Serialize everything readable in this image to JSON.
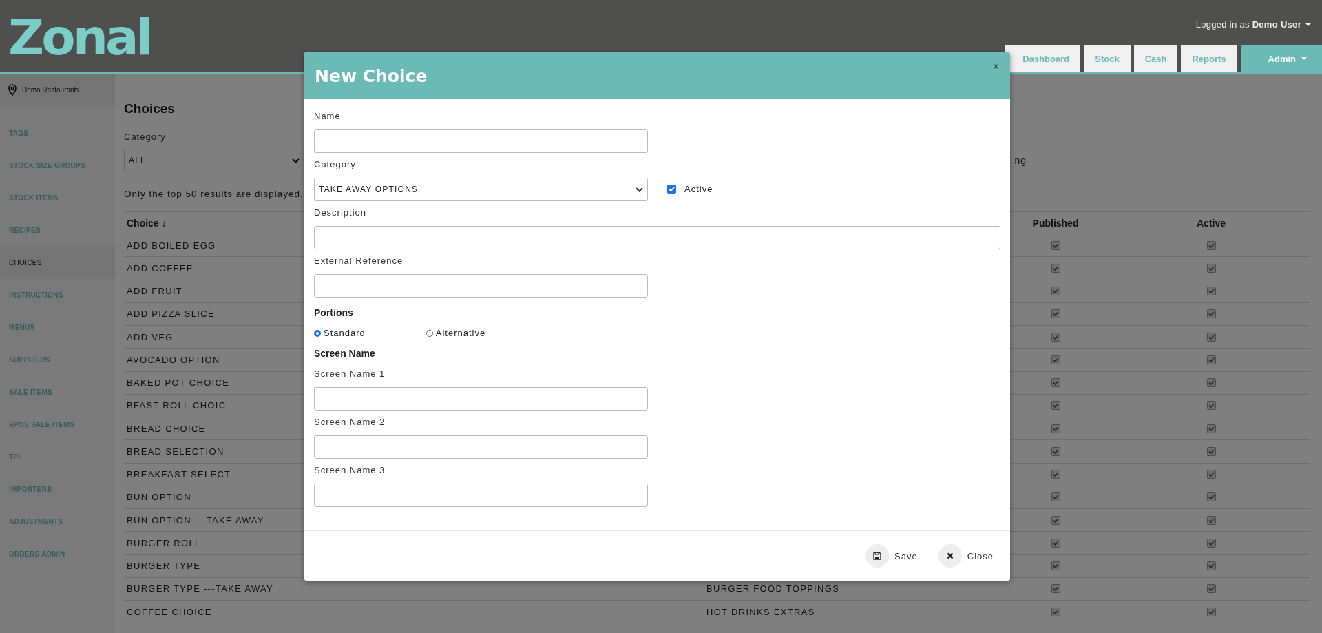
{
  "header": {
    "logo": "Zonal",
    "user": {
      "prefix": "Logged in as",
      "name": "Demo User"
    },
    "nav": [
      {
        "label": "Dashboard",
        "selected": false,
        "dropdown": false
      },
      {
        "label": "Stock",
        "selected": false,
        "dropdown": false
      },
      {
        "label": "Cash",
        "selected": false,
        "dropdown": false
      },
      {
        "label": "Reports",
        "selected": false,
        "dropdown": false
      },
      {
        "label": "Admin",
        "selected": true,
        "dropdown": true
      }
    ]
  },
  "sidebar": {
    "site": "Demo Restaurants",
    "items": [
      {
        "label": "TAGS",
        "selected": false
      },
      {
        "label": "STOCK SIZE GROUPS",
        "selected": false
      },
      {
        "label": "STOCK ITEMS",
        "selected": false
      },
      {
        "label": "RECIPES",
        "selected": false
      },
      {
        "label": "CHOICES",
        "selected": true
      },
      {
        "label": "INSTRUCTIONS",
        "selected": false
      },
      {
        "label": "MENUS",
        "selected": false
      },
      {
        "label": "SUPPLIERS",
        "selected": false
      },
      {
        "label": "SALE ITEMS",
        "selected": false
      },
      {
        "label": "EPOS SALE ITEMS",
        "selected": false
      },
      {
        "label": "TPI",
        "selected": false
      },
      {
        "label": "IMPORTERS",
        "selected": false
      },
      {
        "label": "ADJUSTMENTS",
        "selected": false
      },
      {
        "label": "ORDERS ADMIN",
        "selected": false
      }
    ]
  },
  "page": {
    "title": "Choices",
    "category_label": "Category",
    "category_value": "ALL",
    "filter_fragment": "ng",
    "notice": "Only the top 50 results are displayed.",
    "table": {
      "columns": [
        {
          "label": "Choice",
          "sort_glyph": "↓"
        },
        {
          "label": "Published"
        },
        {
          "label": "Active"
        }
      ],
      "rows": [
        {
          "choice": "ADD BOILED EGG",
          "published": true,
          "active": true
        },
        {
          "choice": "ADD COFFEE",
          "published": true,
          "active": true
        },
        {
          "choice": "ADD FRUIT",
          "published": true,
          "active": true
        },
        {
          "choice": "ADD PIZZA SLICE",
          "published": true,
          "active": true
        },
        {
          "choice": "ADD VEG",
          "published": true,
          "active": true
        },
        {
          "choice": "AVOCADO OPTION",
          "published": true,
          "active": true
        },
        {
          "choice": "BAKED POT CHOICE",
          "published": true,
          "active": true
        },
        {
          "choice": "BFAST ROLL CHOIC",
          "published": true,
          "active": true
        },
        {
          "choice": "BREAD CHOICE",
          "published": true,
          "active": true
        },
        {
          "choice": "BREAD SELECTION",
          "published": true,
          "active": true
        },
        {
          "choice": "BREAKFAST SELECT",
          "published": true,
          "active": true
        },
        {
          "choice": "BUN OPTION",
          "published": true,
          "active": true
        },
        {
          "choice": "BUN OPTION ---TAKE AWAY",
          "published": true,
          "active": true
        },
        {
          "choice": "BURGER ROLL",
          "published": true,
          "active": true
        },
        {
          "choice": "BURGER TYPE",
          "published": true,
          "active": true
        },
        {
          "choice": "BURGER TYPE ---TAKE AWAY",
          "category": "BURGER FOOD TOPPINGS",
          "published": true,
          "active": true
        },
        {
          "choice": "COFFEE CHOICE",
          "category": "HOT DRINKS EXTRAS",
          "published": true,
          "active": true
        }
      ]
    }
  },
  "modal": {
    "title": "New Choice",
    "close_glyph": "×",
    "fields": [
      {
        "kind": "text",
        "label": "Name",
        "wide": false
      },
      {
        "kind": "select",
        "label": "Category",
        "value": "TAKE AWAY OPTIONS",
        "checkbox": {
          "label": "Active",
          "checked": true
        }
      },
      {
        "kind": "text",
        "label": "Description",
        "wide": true
      },
      {
        "kind": "text",
        "label": "External Reference",
        "wide": false
      },
      {
        "kind": "radio",
        "label": "Portions",
        "options": [
          {
            "label": "Standard",
            "selected": true
          },
          {
            "label": "Alternative",
            "selected": false
          }
        ]
      },
      {
        "kind": "heading",
        "label": "Screen Name"
      },
      {
        "kind": "text",
        "label": "Screen Name 1",
        "wide": false
      },
      {
        "kind": "text",
        "label": "Screen Name 2",
        "wide": false
      },
      {
        "kind": "text",
        "label": "Screen Name 3",
        "wide": false
      }
    ],
    "buttons": [
      {
        "label": "Save",
        "kind": "save"
      },
      {
        "label": "Close",
        "kind": "close"
      }
    ]
  }
}
